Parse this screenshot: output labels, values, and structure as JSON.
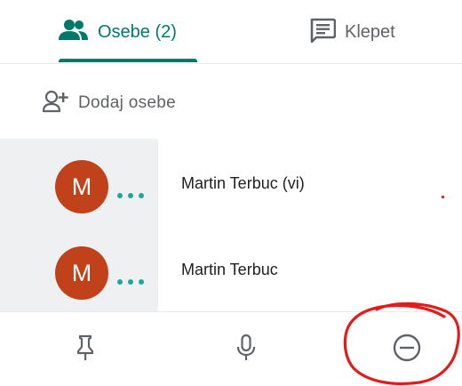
{
  "tabs": {
    "people": {
      "label": "Osebe (2)",
      "icon": "people-icon",
      "active": true
    },
    "chat": {
      "label": "Klepet",
      "icon": "chat-icon",
      "active": false
    }
  },
  "add_people": {
    "label": "Dodaj osebe",
    "icon": "add-person-icon"
  },
  "participants": [
    {
      "initial": "M",
      "name": "Martin Terbuc (vi)",
      "avatar_color": "#c0411a"
    },
    {
      "initial": "M",
      "name": "Martin Terbuc",
      "avatar_color": "#c0411a"
    }
  ],
  "bottom_bar": {
    "pin": {
      "icon": "pin-icon"
    },
    "mic": {
      "icon": "microphone-icon"
    },
    "remove": {
      "icon": "remove-circle-icon"
    }
  },
  "colors": {
    "accent": "#00796b",
    "annotation": "#e31b1b",
    "more_dots": "#1aa99b"
  }
}
